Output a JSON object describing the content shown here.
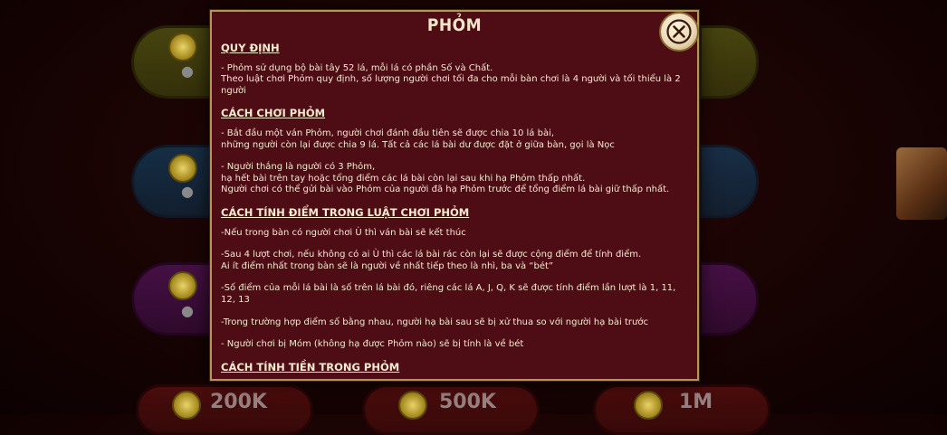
{
  "dialog": {
    "title": "PHỎM",
    "close_label": "×",
    "sections": [
      {
        "heading": "QUY ĐỊNH",
        "paragraphs": [
          "- Phỏm sử dụng bộ bài tây 52 lá, mỗi lá có phần Số và Chất.\nTheo luật chơi Phỏm quy định, số lượng người chơi tối đa cho mỗi bàn chơi là 4 người và tối thiểu là 2 người"
        ]
      },
      {
        "heading": "CÁCH CHƠI PHỎM",
        "paragraphs": [
          "- Bắt đầu một ván Phỏm, người chơi đánh đầu tiên sẽ được chia 10 lá bài,\nnhững người còn lại được chia 9 lá. Tất cả các lá bài dư được đặt ở giữa bàn, gọi là Nọc",
          "- Người thắng là người có 3 Phỏm,\nhạ hết bài trên tay hoặc tổng điểm các lá bài còn lại sau khi hạ Phỏm thấp nhất.\nNgười chơi có thể gửi bài vào Phỏm của người đã hạ Phỏm trước để tổng điểm lá bài giữ thấp nhất."
        ]
      },
      {
        "heading": "CÁCH TÍNH ĐIỂM TRONG LUẬT CHƠI PHỎM",
        "paragraphs": [
          "-Nếu trong bàn có người chơi Ù thì ván bài sẽ kết thúc",
          "-Sau 4 lượt chơi, nếu không có ai Ù thì các lá bài rác còn lại sẽ được cộng điểm để tính điểm.\nAi ít điểm nhất trong bàn sẽ là người về nhất tiếp theo là nhì, ba và “bét”",
          "-Số điểm của mỗi lá bài là số trên lá bài đó, riêng các lá A, J, Q, K sẽ được tính điểm lần lượt là 1, 11, 12, 13",
          "-Trong trường hợp điểm số bằng nhau, người hạ bài sau sẽ bị xử thua so với người hạ bài trước",
          "- Người chơi bị Móm (không hạ được Phỏm nào) sẽ bị tính là về bét"
        ]
      },
      {
        "heading": "CÁCH TÍNH TIỀN TRONG PHỎM",
        "paragraphs": []
      }
    ]
  },
  "background": {
    "stakes": [
      "200K",
      "500K",
      "1M"
    ]
  },
  "colors": {
    "dialog_bg": "#4e0c14",
    "dialog_border": "#b8945a",
    "text": "#f3ead2"
  }
}
